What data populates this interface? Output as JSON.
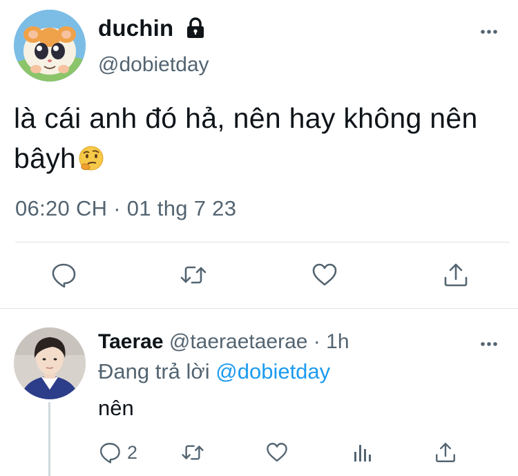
{
  "main_tweet": {
    "author_name": "duchin",
    "author_handle": "@dobietday",
    "text": "là cái anh đó hả, nên hay không nên bâyh",
    "timestamp": "06:20 CH · 01 thg 7 23",
    "icons": {
      "lock": "lock-icon",
      "more": "more-options-icon",
      "emoji": "thinking-face-emoji",
      "actions": [
        "reply-icon",
        "retweet-icon",
        "like-icon",
        "share-icon"
      ]
    }
  },
  "reply": {
    "author_name": "Taerae",
    "author_handle": "@taeraetaerae",
    "separator": "·",
    "time": "1h",
    "replying_label": "Đang trả lời",
    "replying_to": "@dobietday",
    "text": "nên",
    "reply_count": "2",
    "icons": {
      "more": "more-options-icon",
      "actions": [
        "reply-icon",
        "retweet-icon",
        "like-icon",
        "analytics-icon",
        "share-icon"
      ]
    }
  },
  "colors": {
    "text_primary": "#0f1419",
    "text_secondary": "#536471",
    "mention": "#1d9bf0",
    "divider": "#dfe3e6"
  }
}
